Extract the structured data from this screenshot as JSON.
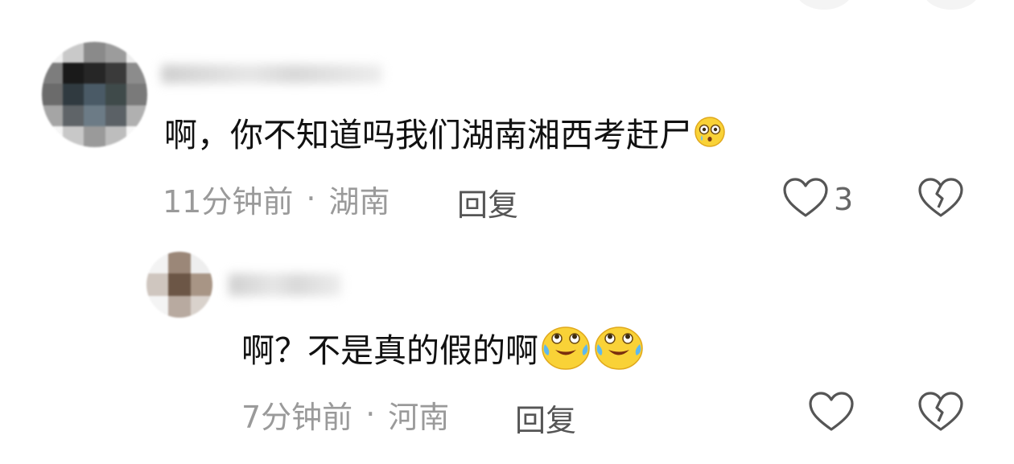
{
  "comments": [
    {
      "text": "啊，你不知道吗我们湖南湘西考赶尸",
      "emoji": [
        "surprised-teary-face-emoji"
      ],
      "time": "11分钟前",
      "separator": "·",
      "location": "湖南",
      "reply_label": "回复",
      "like_count": "3"
    },
    {
      "text": "啊？不是真的假的啊",
      "emoji": [
        "crying-laughing-face-emoji",
        "crying-laughing-face-emoji"
      ],
      "time": "7分钟前",
      "separator": "·",
      "location": "河南",
      "reply_label": "回复",
      "like_count": ""
    }
  ],
  "colors": {
    "text": "#111111",
    "meta": "#9a9a9a",
    "icon": "#555555",
    "emoji_yellow": "#f9d237"
  }
}
